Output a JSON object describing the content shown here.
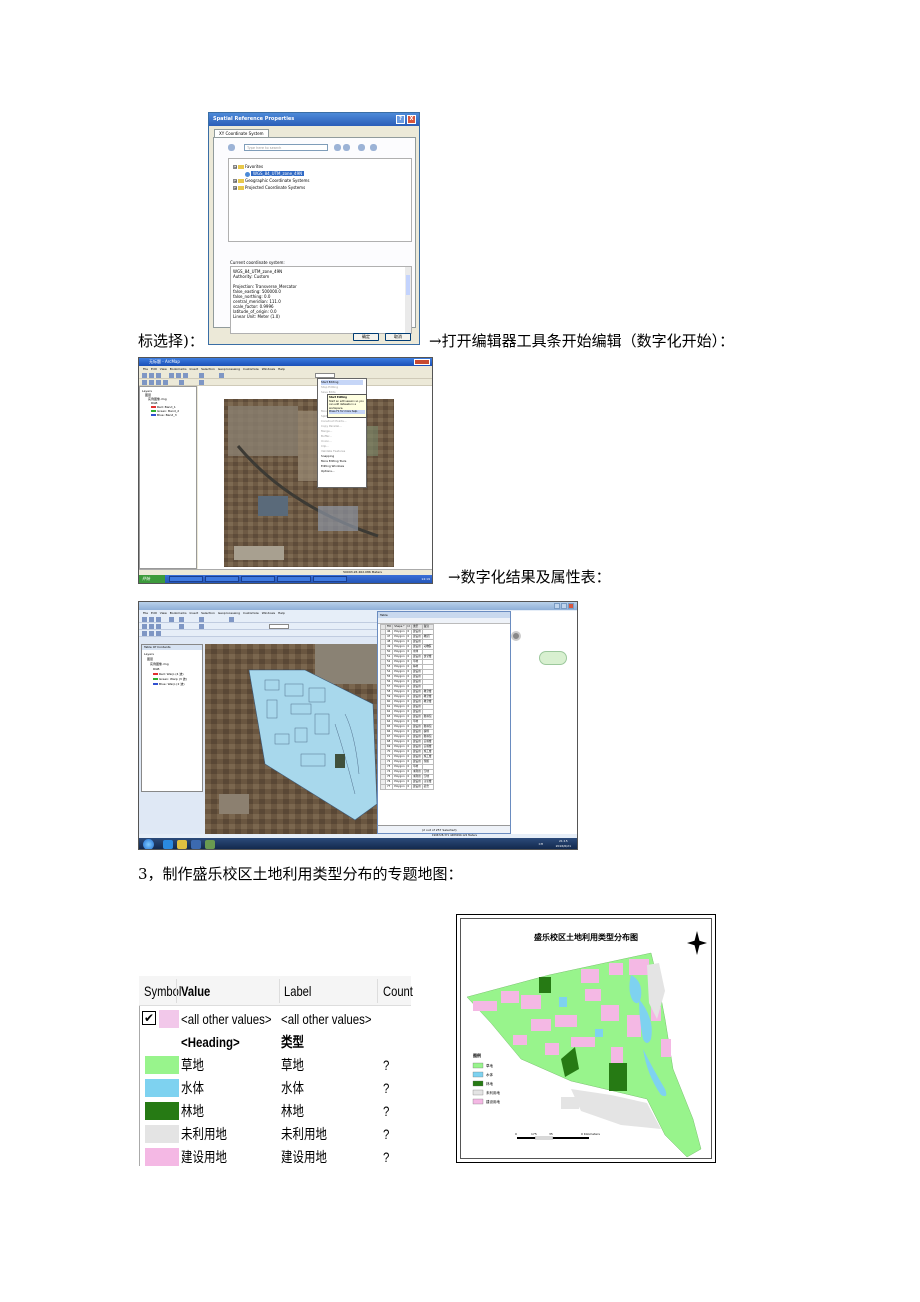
{
  "text": {
    "caption1": "标选择)：",
    "caption2": "→打开编辑器工具条开始编辑（数字化开始）：",
    "caption3": "→数字化结果及属性表：",
    "section3": "3，制作盛乐校区土地利用类型分布的专题地图："
  },
  "dialog": {
    "title": "Spatial Reference Properties",
    "help": "?",
    "close": "X",
    "tab": "XY Coordinate System",
    "search_placeholder": "Type here to search",
    "tree": [
      {
        "label": "Favorites",
        "expander": "⊟"
      },
      {
        "label": "WGS_84_UTM_zone_49N",
        "selected": true
      },
      {
        "label": "Geographic Coordinate Systems",
        "expander": "⊞"
      },
      {
        "label": "Projected Coordinate Systems",
        "expander": "⊞"
      }
    ],
    "current_label": "Current coordinate system:",
    "current_lines": [
      "WGS_84_UTM_zone_49N",
      "Authority: Custom",
      "",
      "Projection: Transverse_Mercator",
      "false_easting: 500000.0",
      "false_northing: 0.0",
      "central_meridian: 111.0",
      "scale_factor: 0.9996",
      "latitude_of_origin: 0.0",
      "Linear Unit: Meter (1.0)"
    ],
    "ok": "确定",
    "cancel": "取消"
  },
  "arc1": {
    "title": "无标题 - ArcMap",
    "menu": "File  Edit  View  Bookmarks  Insert  Selection  Geoprocessing  Customize  Windows  Help",
    "toc": [
      "Layers",
      "图层",
      "实例图像.img",
      "RGB",
      "Red:  Band_1",
      "Green: Band_2",
      "Blue:  Band_3"
    ],
    "dropdown": [
      "Start Editing",
      "Stop Editing",
      "Save Edits",
      "Move...",
      "Split...",
      "Construct Points...",
      "Copy Parallel...",
      "Merge...",
      "Buffer...",
      "Union...",
      "Clip...",
      "Validate Features",
      "Snapping",
      "More Editing Tools",
      "Editing Windows",
      "Options..."
    ],
    "tip_title": "Start Editing",
    "tip_body": "Start an edit session so you can edit datasets in a workspace.",
    "tip_help": "Press F1 for more help.",
    "status": "50093.26  462.086 Meters",
    "start": "开始",
    "clock": "14:19"
  },
  "arc2": {
    "menu": "File  Edit  View  Bookmarks  Insert  Selection  Geoprocessing  Customize  Windows  Help",
    "toc_title": "Table Of Contents",
    "toc": [
      "Layers",
      "图层",
      "实例图像.img",
      "RGB",
      "Red:   Warp (4 波)",
      "Green: Warp (3 波)",
      "Blue:  Warp (2 波)"
    ],
    "table_title": "Table",
    "columns": [
      "FID",
      "Shape *",
      "Id",
      "类型",
      "备注"
    ],
    "rows": [
      [
        "46",
        "Polygon",
        "0",
        "建设用",
        ""
      ],
      [
        "47",
        "Polygon",
        "0",
        "建设用",
        "教研厂"
      ],
      [
        "48",
        "Polygon",
        "0",
        "建设用",
        ""
      ],
      [
        "49",
        "Polygon",
        "0",
        "建设用",
        "动物医"
      ],
      [
        "50",
        "Polygon",
        "0",
        "水体",
        ""
      ],
      [
        "51",
        "Polygon",
        "0",
        "建设用",
        "食堂楼"
      ],
      [
        "52",
        "Polygon",
        "0",
        "草地",
        ""
      ],
      [
        "53",
        "Polygon",
        "0",
        "林地",
        ""
      ],
      [
        "54",
        "Polygon",
        "0",
        "建设用",
        ""
      ],
      [
        "55",
        "Polygon",
        "0",
        "建设用",
        ""
      ],
      [
        "56",
        "Polygon",
        "0",
        "建设用",
        ""
      ],
      [
        "57",
        "Polygon",
        "0",
        "建设用",
        ""
      ],
      [
        "58",
        "Polygon",
        "0",
        "建设用",
        "教室楼"
      ],
      [
        "59",
        "Polygon",
        "0",
        "建设用",
        "教室楼"
      ],
      [
        "60",
        "Polygon",
        "0",
        "建设用",
        "教室楼"
      ],
      [
        "61",
        "Polygon",
        "0",
        "建设用",
        ""
      ],
      [
        "62",
        "Polygon",
        "0",
        "建设用",
        ""
      ],
      [
        "63",
        "Polygon",
        "0",
        "建设用",
        "图书馆"
      ],
      [
        "64",
        "Polygon",
        "0",
        "草地",
        ""
      ],
      [
        "65",
        "Polygon",
        "0",
        "建设用",
        "图书馆"
      ],
      [
        "66",
        "Polygon",
        "0",
        "建设用",
        "操场"
      ],
      [
        "67",
        "Polygon",
        "0",
        "建设用",
        "图书馆"
      ],
      [
        "68",
        "Polygon",
        "0",
        "建设用",
        "实验楼"
      ],
      [
        "69",
        "Polygon",
        "0",
        "建设用",
        "实验楼"
      ],
      [
        "70",
        "Polygon",
        "0",
        "建设用",
        "施工楼"
      ],
      [
        "71",
        "Polygon",
        "0",
        "建设用",
        "施工楼"
      ],
      [
        "72",
        "Polygon",
        "0",
        "建设用",
        "预留"
      ],
      [
        "73",
        "Polygon",
        "0",
        "草地",
        ""
      ],
      [
        "74",
        "Polygon",
        "0",
        "未利用",
        "空地"
      ],
      [
        "75",
        "Polygon",
        "0",
        "未利用",
        "空地"
      ],
      [
        "76",
        "Polygon",
        "0",
        "建设用",
        "讨论楼"
      ],
      [
        "77",
        "Polygon",
        "0",
        "建设用",
        "宿舍"
      ]
    ],
    "footer": "(2 out of 257 Selected)",
    "status": "1996728.371  4483090.122 Meters",
    "clock_time": "21:15",
    "clock_date": "2016/6/21",
    "tray": "CH"
  },
  "symbology": {
    "headers": {
      "symbol": "Symbol",
      "value": "Value",
      "label": "Label",
      "count": "Count"
    },
    "check": "✔",
    "rows": [
      {
        "value": "<all other values>",
        "label": "<all other values>",
        "count": "",
        "color": "#f2c8ea",
        "bold": false
      },
      {
        "value": "<Heading>",
        "label": "类型",
        "count": "",
        "color": null,
        "bold": true
      },
      {
        "value": "草地",
        "label": "草地",
        "count": "?",
        "color": "#98f48c",
        "bold": false
      },
      {
        "value": "水体",
        "label": "水体",
        "count": "?",
        "color": "#7ed2f0",
        "bold": false
      },
      {
        "value": "林地",
        "label": "林地",
        "count": "?",
        "color": "#267a14",
        "bold": false
      },
      {
        "value": "未利用地",
        "label": "未利用地",
        "count": "?",
        "color": "#e4e4e4",
        "bold": false
      },
      {
        "value": "建设用地",
        "label": "建设用地",
        "count": "?",
        "color": "#f4b8e4",
        "bold": false
      }
    ]
  },
  "thematic_map": {
    "title": "盛乐校区土地利用类型分布图",
    "legend_title": "图例",
    "legend": [
      {
        "label": "草地",
        "color": "#98f48c"
      },
      {
        "label": "水体",
        "color": "#7ed2f0"
      },
      {
        "label": "林地",
        "color": "#267a14"
      },
      {
        "label": "未利用地",
        "color": "#e4e4e4"
      },
      {
        "label": "建设用地",
        "color": "#f4b8e4"
      }
    ],
    "scale_labels": [
      "0",
      "175",
      "35",
      "0 Kilometers"
    ]
  }
}
